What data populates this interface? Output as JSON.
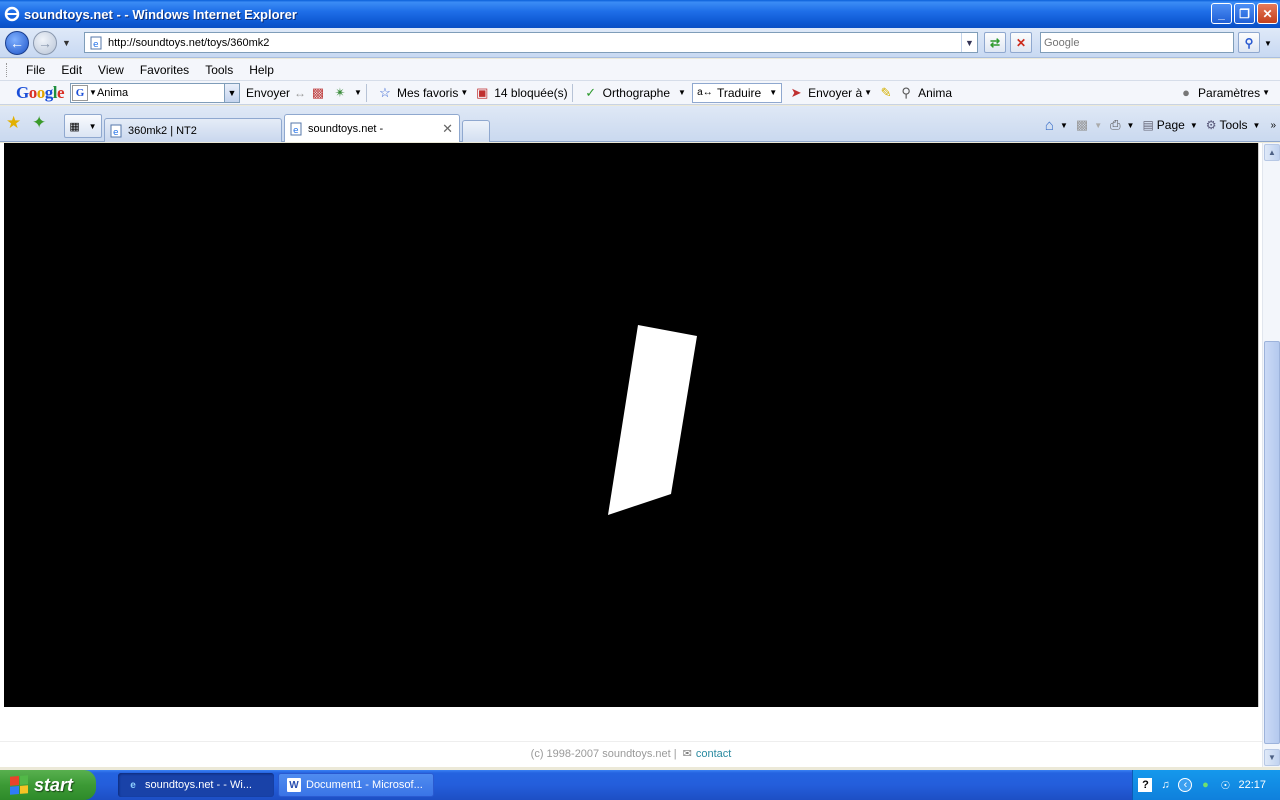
{
  "window": {
    "title": "soundtoys.net - - Windows Internet Explorer",
    "buttons": {
      "minimize": "_",
      "maximize": "❐",
      "close": "✕"
    }
  },
  "address_bar": {
    "url": "http://soundtoys.net/toys/360mk2",
    "search_placeholder": "Google"
  },
  "menu": [
    "File",
    "Edit",
    "View",
    "Favorites",
    "Tools",
    "Help"
  ],
  "google_toolbar": {
    "search_value": "Anima",
    "envoyer": "Envoyer",
    "mes_favoris": "Mes favoris",
    "bloquees": "14 bloquée(s)",
    "orthographe": "Orthographe",
    "traduire": "Traduire",
    "envoyer_a": "Envoyer à",
    "anima": "Anima",
    "parametres": "Paramètres"
  },
  "tabs": [
    {
      "label": "360mk2 | NT2",
      "active": false
    },
    {
      "label": "soundtoys.net -",
      "active": true
    }
  ],
  "command_bar": {
    "page": "Page",
    "tools": "Tools"
  },
  "page": {
    "stage_background": "#000000",
    "shape_color": "#ffffff",
    "footer_copyright": "(c) 1998-2007 soundtoys.net |",
    "footer_contact": "contact"
  },
  "taskbar": {
    "start": "start",
    "items": [
      {
        "label": "soundtoys.net - - Wi...",
        "active": true
      },
      {
        "label": "Document1 - Microsof...",
        "active": false
      }
    ],
    "clock": "22:17"
  },
  "icons": [
    "ie-logo-icon",
    "back-arrow-icon",
    "forward-arrow-icon",
    "page-icon",
    "refresh-icon",
    "stop-icon",
    "search-icon",
    "star-icon",
    "add-favorite-icon",
    "home-icon",
    "rss-icon",
    "print-icon",
    "gear-icon",
    "windows-flag-icon",
    "word-icon",
    "help-icon",
    "speaker-icon",
    "network-icon"
  ],
  "colors": {
    "titlebar": "#0d58d2",
    "taskbar": "#245edb",
    "start": "#3c9a35",
    "link": "#2a8aa0"
  }
}
